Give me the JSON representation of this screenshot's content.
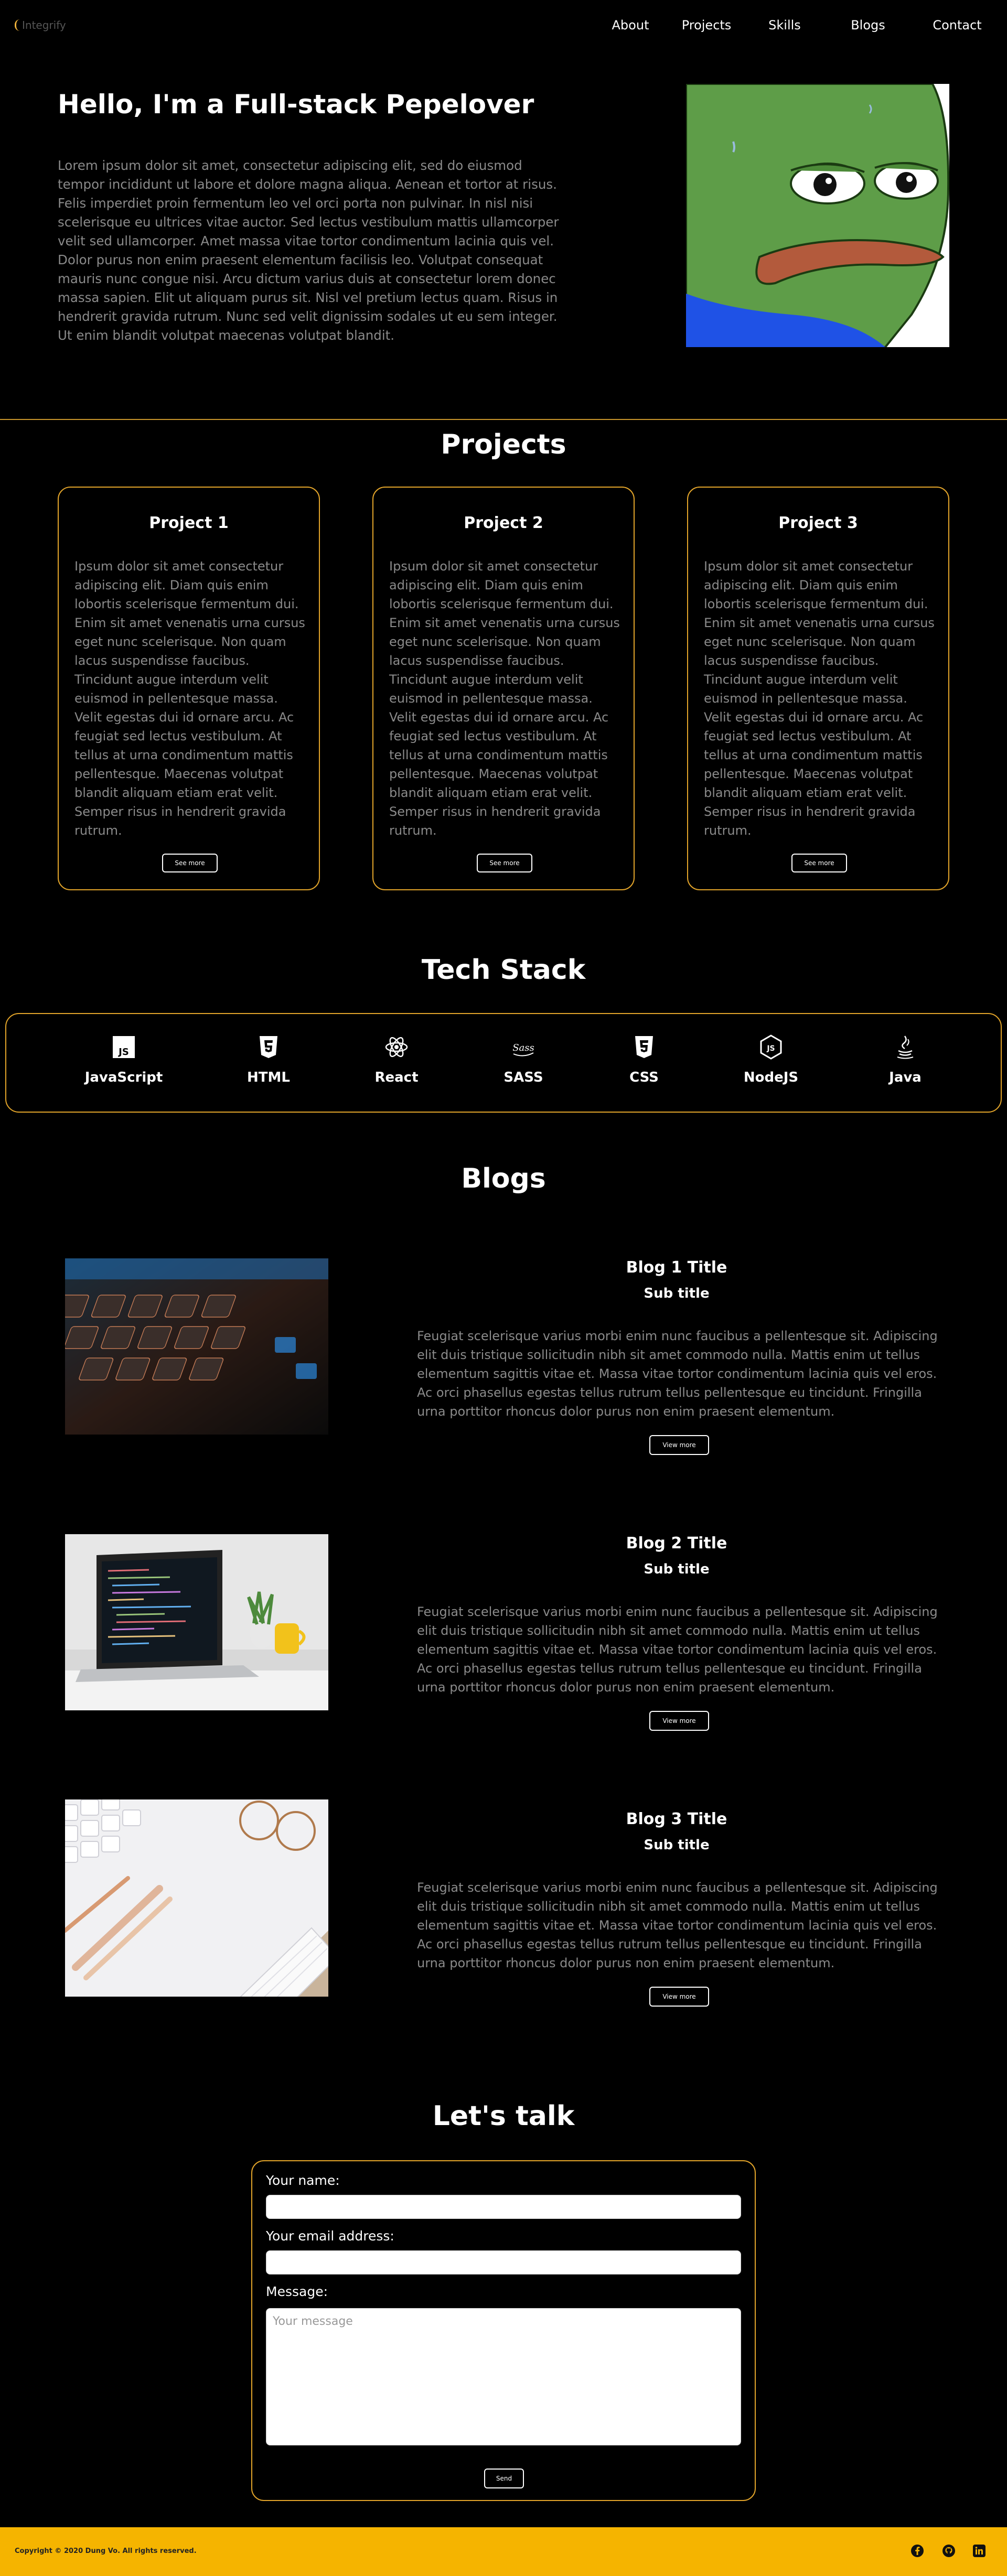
{
  "nav": {
    "logo_text": "Integrify",
    "links": [
      "About",
      "Projects",
      "Skills",
      "Blogs",
      "Contact"
    ]
  },
  "hero": {
    "title": "Hello, I'm a Full-stack Pepelover",
    "text": "Lorem ipsum dolor sit amet, consectetur adipiscing elit, sed do eiusmod tempor incididunt ut labore et dolore magna aliqua. Aenean et tortor at risus. Felis imperdiet proin fermentum leo vel orci porta non pulvinar. In nisl nisi scelerisque eu ultrices vitae auctor. Sed lectus vestibulum mattis ullamcorper velit sed ullamcorper. Amet massa vitae tortor condimentum lacinia quis vel. Dolor purus non enim praesent elementum facilisis leo. Volutpat consequat mauris nunc congue nisi. Arcu dictum varius duis at consectetur lorem donec massa sapien. Elit ut aliquam purus sit. Nisl vel pretium lectus quam. Risus in hendrerit gravida rutrum. Nunc sed velit dignissim sodales ut eu sem integer. Ut enim blandit volutpat maecenas volutpat blandit."
  },
  "projects": {
    "heading": "Projects",
    "items": [
      {
        "title": "Project 1",
        "text": "Ipsum dolor sit amet consectetur adipiscing elit. Diam quis enim lobortis scelerisque fermentum dui. Enim sit amet venenatis urna cursus eget nunc scelerisque. Non quam lacus suspendisse faucibus. Tincidunt augue interdum velit euismod in pellentesque massa. Velit egestas dui id ornare arcu. Ac feugiat sed lectus vestibulum. At tellus at urna condimentum mattis pellentesque. Maecenas volutpat blandit aliquam etiam erat velit. Semper risus in hendrerit gravida rutrum.",
        "button": "See more"
      },
      {
        "title": "Project 2",
        "text": "Ipsum dolor sit amet consectetur adipiscing elit. Diam quis enim lobortis scelerisque fermentum dui. Enim sit amet venenatis urna cursus eget nunc scelerisque. Non quam lacus suspendisse faucibus. Tincidunt augue interdum velit euismod in pellentesque massa. Velit egestas dui id ornare arcu. Ac feugiat sed lectus vestibulum. At tellus at urna condimentum mattis pellentesque. Maecenas volutpat blandit aliquam etiam erat velit. Semper risus in hendrerit gravida rutrum.",
        "button": "See more"
      },
      {
        "title": "Project 3",
        "text": "Ipsum dolor sit amet consectetur adipiscing elit. Diam quis enim lobortis scelerisque fermentum dui. Enim sit amet venenatis urna cursus eget nunc scelerisque. Non quam lacus suspendisse faucibus. Tincidunt augue interdum velit euismod in pellentesque massa. Velit egestas dui id ornare arcu. Ac feugiat sed lectus vestibulum. At tellus at urna condimentum mattis pellentesque. Maecenas volutpat blandit aliquam etiam erat velit. Semper risus in hendrerit gravida rutrum.",
        "button": "See more"
      }
    ]
  },
  "tech": {
    "heading": "Tech Stack",
    "items": [
      {
        "label": "JavaScript",
        "icon": "javascript-icon"
      },
      {
        "label": "HTML",
        "icon": "html5-icon"
      },
      {
        "label": "React",
        "icon": "react-icon"
      },
      {
        "label": "SASS",
        "icon": "sass-icon"
      },
      {
        "label": "CSS",
        "icon": "css3-icon"
      },
      {
        "label": "NodeJS",
        "icon": "nodejs-icon"
      },
      {
        "label": "Java",
        "icon": "java-icon"
      }
    ]
  },
  "blogs": {
    "heading": "Blogs",
    "items": [
      {
        "title": "Blog 1 Title",
        "subtitle": "Sub title",
        "text": "Feugiat scelerisque varius morbi enim nunc faucibus a pellentesque sit. Adipiscing elit duis tristique sollicitudin nibh sit amet commodo nulla. Mattis enim ut tellus elementum sagittis vitae et. Massa vitae tortor condimentum lacinia quis vel eros. Ac orci phasellus egestas tellus rutrum tellus pellentesque eu tincidunt. Fringilla urna porttitor rhoncus dolor purus non enim praesent elementum.",
        "button": "View more"
      },
      {
        "title": "Blog 2 Title",
        "subtitle": "Sub title",
        "text": "Feugiat scelerisque varius morbi enim nunc faucibus a pellentesque sit. Adipiscing elit duis tristique sollicitudin nibh sit amet commodo nulla. Mattis enim ut tellus elementum sagittis vitae et. Massa vitae tortor condimentum lacinia quis vel eros. Ac orci phasellus egestas tellus rutrum tellus pellentesque eu tincidunt. Fringilla urna porttitor rhoncus dolor purus non enim praesent elementum.",
        "button": "View more"
      },
      {
        "title": "Blog 3 Title",
        "subtitle": "Sub title",
        "text": "Feugiat scelerisque varius morbi enim nunc faucibus a pellentesque sit. Adipiscing elit duis tristique sollicitudin nibh sit amet commodo nulla. Mattis enim ut tellus elementum sagittis vitae et. Massa vitae tortor condimentum lacinia quis vel eros. Ac orci phasellus egestas tellus rutrum tellus pellentesque eu tincidunt. Fringilla urna porttitor rhoncus dolor purus non enim praesent elementum.",
        "button": "View more"
      }
    ]
  },
  "contact": {
    "heading": "Let's talk",
    "name_label": "Your name:",
    "name_value": "",
    "email_label": "Your email address:",
    "email_value": "",
    "message_label": "Message:",
    "message_placeholder": "Your message",
    "send_label": "Send"
  },
  "footer": {
    "copyright": "Copyright © 2020 Dung Vo. All rights reserved.",
    "social_icons": [
      "facebook-icon",
      "github-icon",
      "linkedin-icon"
    ]
  },
  "colors": {
    "accent": "#e2a42a",
    "footer_bg": "#f5b400",
    "background": "#000000",
    "muted_text": "#8a8a8a"
  }
}
